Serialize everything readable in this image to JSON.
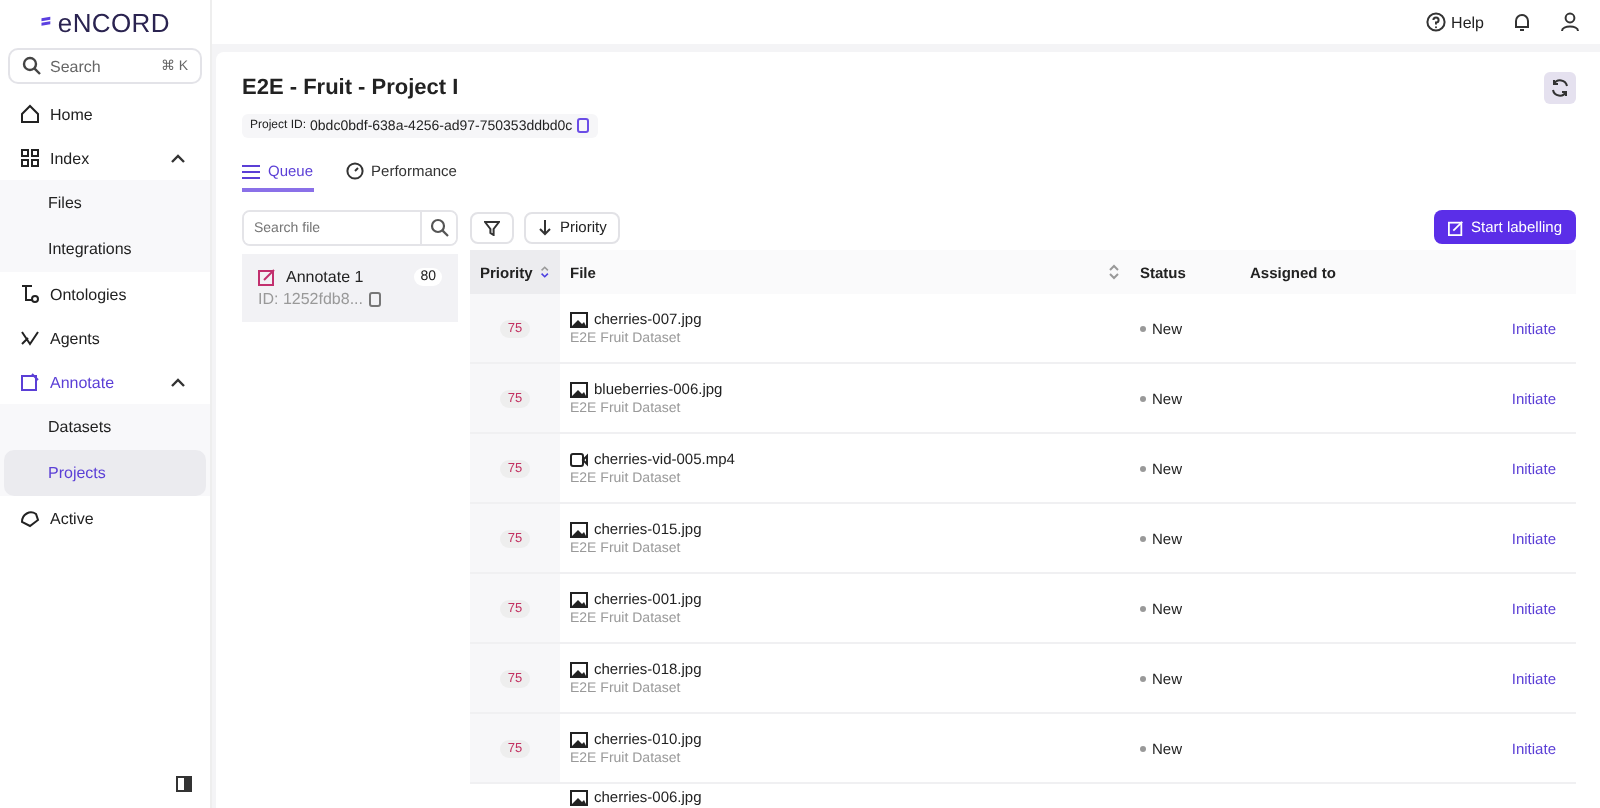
{
  "logo": "eNCORD",
  "sidebar": {
    "search": {
      "placeholder": "Search",
      "shortcut": "⌘ K"
    },
    "items": [
      {
        "label": "Home",
        "selected": false
      },
      {
        "label": "Index",
        "selected": false,
        "expanded": true,
        "children": [
          {
            "label": "Files",
            "selected": false
          },
          {
            "label": "Integrations",
            "selected": false
          }
        ]
      },
      {
        "label": "Ontologies",
        "selected": false
      },
      {
        "label": "Agents",
        "selected": false
      },
      {
        "label": "Annotate",
        "selected": true,
        "expanded": true,
        "children": [
          {
            "label": "Datasets",
            "selected": false
          },
          {
            "label": "Projects",
            "selected": true
          }
        ]
      },
      {
        "label": "Active",
        "selected": false
      }
    ]
  },
  "topbar": {
    "help": "Help"
  },
  "project": {
    "title": "E2E - Fruit - Project I",
    "id_label": "Project ID:",
    "id": "0bdc0bdf-638a-4256-ad97-750353ddbd0c"
  },
  "tabs": [
    {
      "label": "Queue",
      "selected": true
    },
    {
      "label": "Performance",
      "selected": false
    }
  ],
  "queue": {
    "search_placeholder": "Search file",
    "stages": [
      {
        "name": "Annotate 1",
        "count": "80",
        "id": "ID: 1252fdb8...",
        "selected": true
      }
    ]
  },
  "toolbar": {
    "sort": "Priority",
    "start": "Start labelling"
  },
  "table": {
    "columns": [
      "Priority",
      "File",
      "Status",
      "Assigned to"
    ],
    "rows": [
      {
        "priority": "75",
        "kind": "image",
        "file": "cherries-007.jpg",
        "dataset": "E2E Fruit Dataset",
        "status": "New",
        "action": "Initiate"
      },
      {
        "priority": "75",
        "kind": "image",
        "file": "blueberries-006.jpg",
        "dataset": "E2E Fruit Dataset",
        "status": "New",
        "action": "Initiate"
      },
      {
        "priority": "75",
        "kind": "video",
        "file": "cherries-vid-005.mp4",
        "dataset": "E2E Fruit Dataset",
        "status": "New",
        "action": "Initiate"
      },
      {
        "priority": "75",
        "kind": "image",
        "file": "cherries-015.jpg",
        "dataset": "E2E Fruit Dataset",
        "status": "New",
        "action": "Initiate"
      },
      {
        "priority": "75",
        "kind": "image",
        "file": "cherries-001.jpg",
        "dataset": "E2E Fruit Dataset",
        "status": "New",
        "action": "Initiate"
      },
      {
        "priority": "75",
        "kind": "image",
        "file": "cherries-018.jpg",
        "dataset": "E2E Fruit Dataset",
        "status": "New",
        "action": "Initiate"
      },
      {
        "priority": "75",
        "kind": "image",
        "file": "cherries-010.jpg",
        "dataset": "E2E Fruit Dataset",
        "status": "New",
        "action": "Initiate"
      },
      {
        "kind": "image",
        "file": "cherries-006.jpg"
      }
    ]
  }
}
